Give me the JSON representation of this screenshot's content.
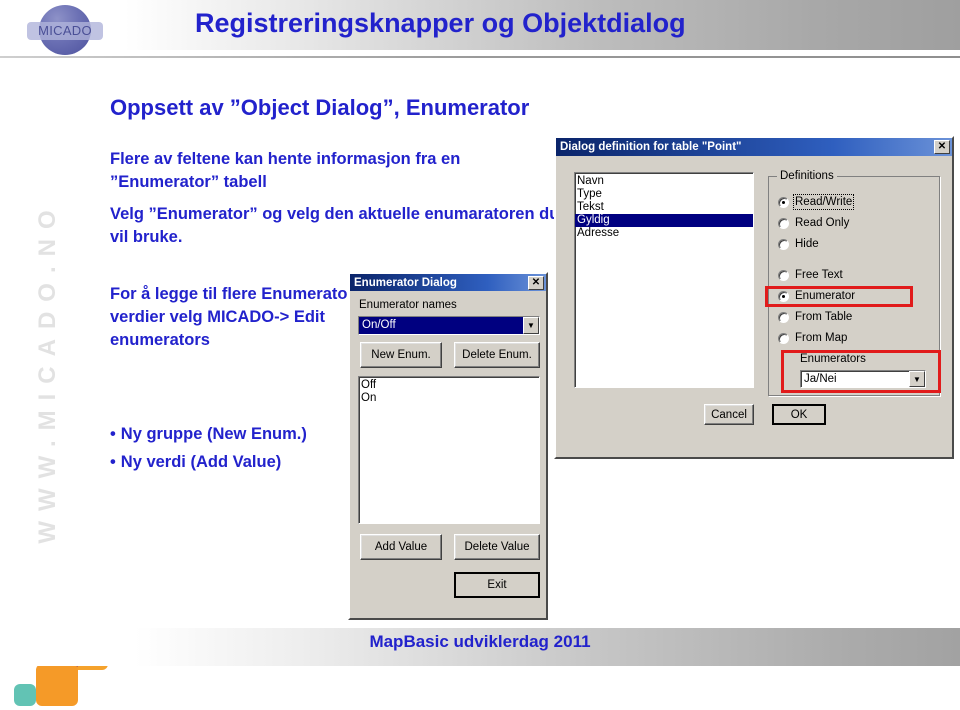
{
  "header": {
    "title": "Registreringsknapper og Objektdialog",
    "logo_text": "MICADO"
  },
  "sidebar": {
    "vertical_text": "WWW.MICADO.NO",
    "colors": {
      "purple": "#7b1f7f",
      "orange": "#f5a22c",
      "teal": "#62c3b4"
    }
  },
  "slide": {
    "title": "Oppsett av ”Object Dialog”, Enumerator",
    "paragraph_1": "Flere av feltene kan hente informasjon fra en ”Enumerator” tabell",
    "paragraph_2": "Velg ”Enumerator” og velg den aktuelle enumaratoren du vil bruke.",
    "paragraph_3": "For å legge til flere Enumerator verdier velg MICADO-> Edit enumerators",
    "bullets": [
      "Ny gruppe (New Enum.)",
      "Ny verdi (Add Value)"
    ],
    "bullet_marker": "•"
  },
  "enumerator_dialog": {
    "title": "Enumerator Dialog",
    "close_label": "✕",
    "names_label": "Enumerator names",
    "selected_name": "On/Off",
    "dropdown_arrow": "▼",
    "new_enum_button": "New Enum.",
    "delete_enum_button": "Delete Enum.",
    "values": [
      "Off",
      "On"
    ],
    "add_value_button": "Add Value",
    "delete_value_button": "Delete Value",
    "exit_button": "Exit"
  },
  "dialog_definition": {
    "title": "Dialog definition for table \"Point\"",
    "close_label": "✕",
    "fields": [
      "Navn",
      "Type",
      "Tekst",
      "Gyldig",
      "Adresse"
    ],
    "selected_field": "Gyldig",
    "definitions_group_label": "Definitions",
    "access_options": [
      {
        "label": "Read/Write",
        "selected": true
      },
      {
        "label": "Read Only",
        "selected": false
      },
      {
        "label": "Hide",
        "selected": false
      }
    ],
    "source_options": [
      {
        "label": "Free Text",
        "selected": false
      },
      {
        "label": "Enumerator",
        "selected": true
      },
      {
        "label": "From Table",
        "selected": false
      },
      {
        "label": "From Map",
        "selected": false
      }
    ],
    "enumerators_label": "Enumerators",
    "enumerators_value": "Ja/Nei",
    "dropdown_arrow": "▼",
    "cancel_button": "Cancel",
    "ok_button": "OK",
    "highlight_color": "#e11b1b"
  },
  "footer": {
    "text": "MapBasic udviklerdag 2011"
  }
}
